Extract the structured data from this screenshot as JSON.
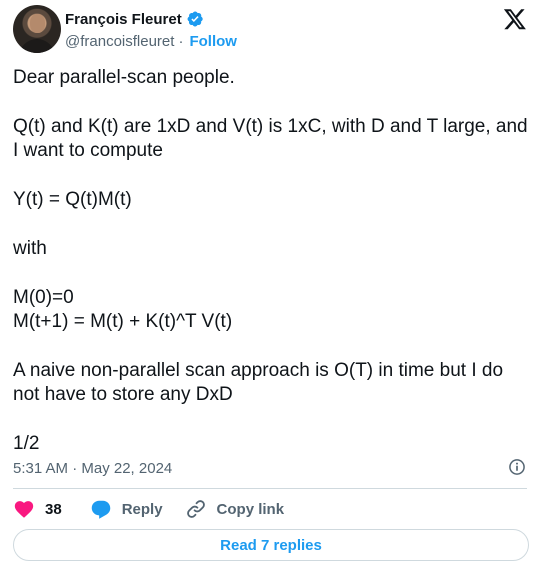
{
  "author": {
    "display_name": "François Fleuret",
    "handle": "@francoisfleuret",
    "follow_label": "Follow",
    "verified": true
  },
  "tweet": {
    "text": "Dear parallel-scan people.\n\nQ(t) and K(t) are 1xD and V(t) is 1xC, with D and T large, and I want to compute\n\nY(t) = Q(t)M(t)\n\nwith\n\nM(0)=0\nM(t+1) = M(t) + K(t)^T V(t)\n\nA naive non-parallel scan approach is O(T) in time but I do not have to store any DxD\n\n1/2",
    "timestamp": "5:31 AM · May 22, 2024"
  },
  "actions": {
    "like_count": "38",
    "reply_label": "Reply",
    "copy_link_label": "Copy link",
    "read_replies_label": "Read 7 replies"
  },
  "colors": {
    "accent": "#1d9bf0",
    "like": "#f91880",
    "text": "#0f1419",
    "muted": "#536471",
    "border": "#cfd9de"
  },
  "icons": [
    "x-logo-icon",
    "verified-badge-icon",
    "info-icon",
    "heart-icon",
    "reply-bubble-icon",
    "link-icon"
  ]
}
